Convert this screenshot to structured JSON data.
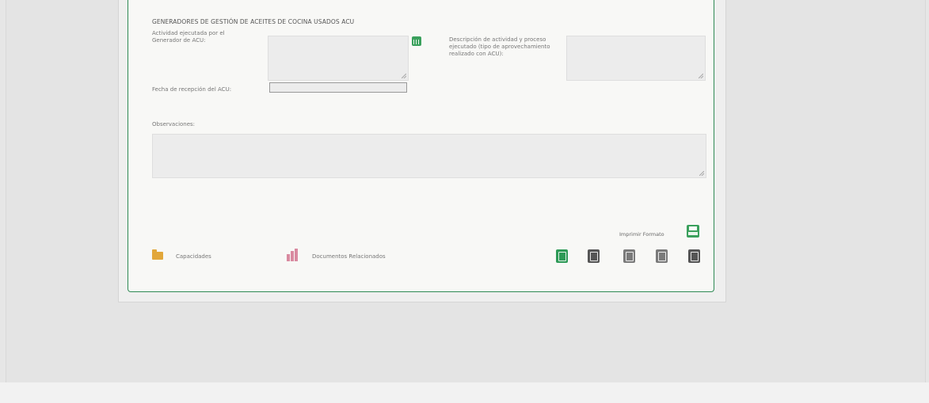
{
  "section_title": "GENERADORES DE GESTIÓN DE ACEITES DE COCINA USADOS ACU",
  "fields": {
    "actividad_label": "Actividad ejecutada por el Generador de ACU:",
    "descripcion_label": "Descripción de actividad y proceso ejecutado (tipo de aprovechamiento realizado con ACU):",
    "fecha_label": "Fecha de recepción del ACU:",
    "observaciones_label": "Observaciones:"
  },
  "print": {
    "label": "Imprimir Formato"
  },
  "links": {
    "capacidades": "Capacidades",
    "documentos": "Documentos Relacionados"
  },
  "icons": {
    "calendar": "calendar-icon",
    "printer": "printer-icon",
    "folder": "folder-icon",
    "documents": "documents-icon",
    "new": "new-record-icon",
    "delete": "delete-icon",
    "edit": "edit-icon",
    "save": "save-icon",
    "cancel": "cancel-icon"
  },
  "colors": {
    "accent": "#2e9a57",
    "folder": "#e2a73a",
    "documents": "#d98aa0"
  }
}
